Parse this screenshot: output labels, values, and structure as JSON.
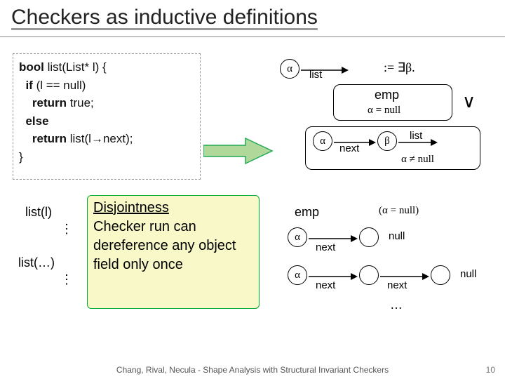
{
  "title": "Checkers as inductive definitions",
  "code": {
    "l1a": "bool",
    "l1b": " list(List* l) {",
    "l2a": "  if",
    "l2b": " (l == null)",
    "l3a": "    return",
    "l3b": " true;",
    "l4a": "  else",
    "l5a": "    return",
    "l5b": " list(l→next);",
    "l6": "}"
  },
  "def": {
    "alpha": "α",
    "beta": "β",
    "list": "list",
    "assign_exists": ":=  ∃β.",
    "emp": "emp",
    "eqnull": "α = null",
    "or": "∨",
    "next": "next",
    "notnull": "α ≠ null"
  },
  "calls": {
    "c1": "list(l)",
    "c2": "list(…)",
    "dots": "⋮"
  },
  "callout": {
    "head": "Disjointness",
    "body": "Checker run can dereference any object field only once"
  },
  "expand": {
    "emp": "emp",
    "eqnull": "(α = null)",
    "alpha": "α",
    "null": "null",
    "next": "next",
    "ellipsis": "…"
  },
  "footer": "Chang, Rival, Necula - Shape Analysis with Structural Invariant Checkers",
  "pagenum": "10"
}
